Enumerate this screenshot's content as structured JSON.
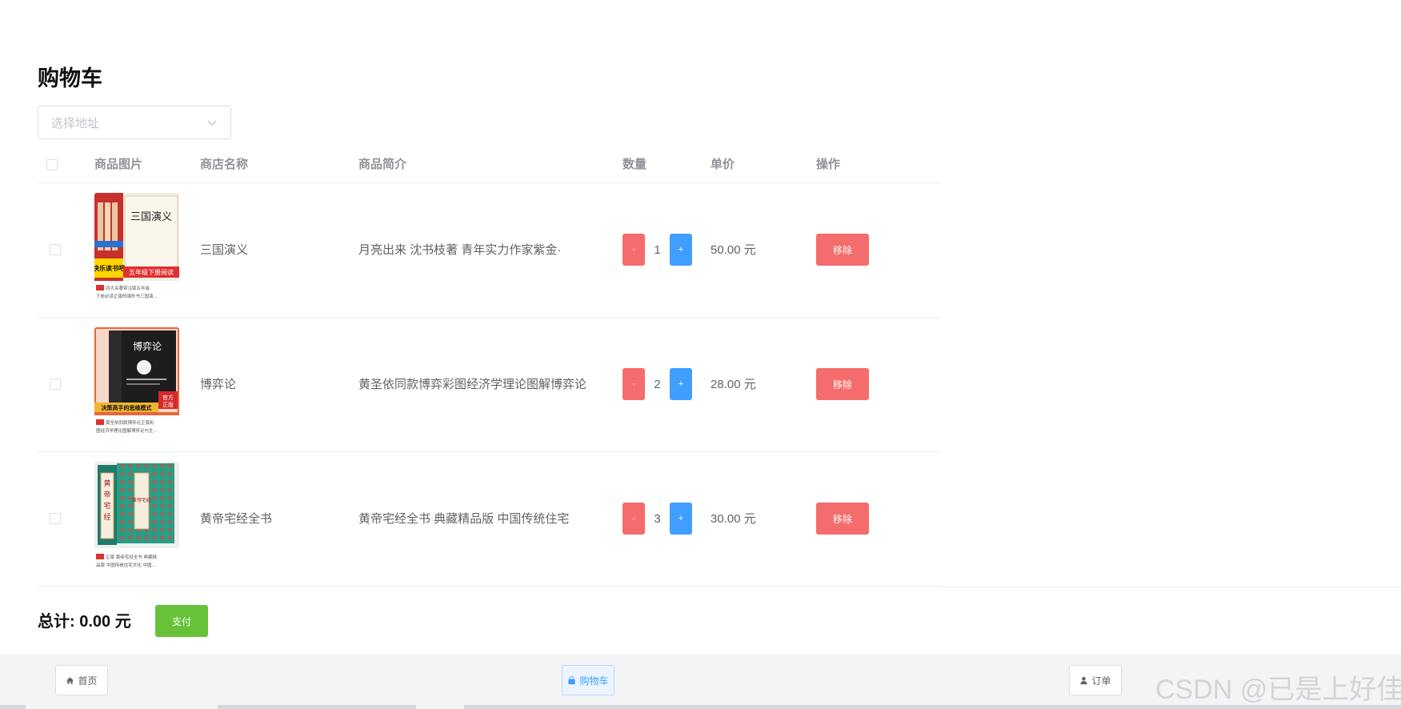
{
  "page": {
    "title": "购物车"
  },
  "address_select": {
    "placeholder": "选择地址",
    "icon": "chevron-down-icon"
  },
  "table": {
    "headers": {
      "image": "商品图片",
      "shop": "商店名称",
      "description": "商品简介",
      "quantity": "数量",
      "price": "单价",
      "actions": "操作"
    },
    "rows": [
      {
        "shop": "三国演义",
        "description": "月亮出来 沈书枝著 青年实力作家紫金·",
        "quantity": "1",
        "price": "50.00 元",
        "minus_label": "-",
        "plus_label": "+",
        "remove_label": "移除",
        "image_caption": "四大名著带注版五年级下册必读正版的课外书三国演...",
        "image_cover_title": "三国演义",
        "image_banner": "五年级下册阅读"
      },
      {
        "shop": "博弈论",
        "description": "黄圣依同款博弈彩图经济学理论图解博弈论",
        "quantity": "2",
        "price": "28.00 元",
        "minus_label": "-",
        "plus_label": "+",
        "remove_label": "移除",
        "image_caption": "黄圣依同款博弈论正版彩图经济学理论图解博弈论与生...",
        "image_cover_title": "博弈论",
        "image_banner": "决策高手的思维模式"
      },
      {
        "shop": "黄帝宅经全书",
        "description": "黄帝宅经全书 典藏精品版 中国传统住宅",
        "quantity": "3",
        "price": "30.00 元",
        "minus_label": "-",
        "plus_label": "+",
        "remove_label": "移除",
        "image_caption": "正版 黄帝宅经全书 典藏精品版 中国传统住宅文化 中国...",
        "image_cover_title": "黄帝宅经",
        "image_banner": ""
      }
    ]
  },
  "summary": {
    "total_label": "总计: 0.00 元",
    "pay_label": "支付"
  },
  "footer_nav": {
    "home": {
      "label": "首页",
      "icon": "home-icon"
    },
    "cart": {
      "label": "购物车",
      "icon": "shopping-bag-icon"
    },
    "orders": {
      "label": "订单",
      "icon": "user-icon"
    }
  },
  "watermark": "CSDN @已是上好佳",
  "colors": {
    "danger": "#f56c6c",
    "primary": "#409eff",
    "success": "#67c23a",
    "border": "#ebeef5"
  }
}
